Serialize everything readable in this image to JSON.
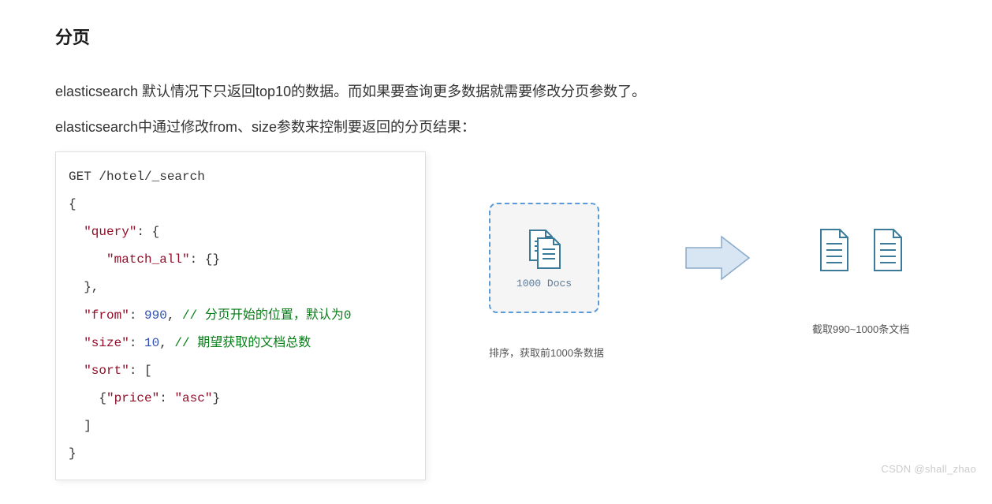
{
  "heading": "分页",
  "para1": "elasticsearch 默认情况下只返回top10的数据。而如果要查询更多数据就需要修改分页参数了。",
  "para2": "elasticsearch中通过修改from、size参数来控制要返回的分页结果：",
  "code": {
    "line1": "GET /hotel/_search",
    "open": "{",
    "queryKey": "\"query\"",
    "matchAllKey": "\"match_all\"",
    "fromKey": "\"from\"",
    "fromVal": "990",
    "fromComment": "// 分页开始的位置，默认为0",
    "sizeKey": "\"size\"",
    "sizeVal": "10",
    "sizeComment": "// 期望获取的文档总数",
    "sortKey": "\"sort\"",
    "priceKey": "\"price\"",
    "priceVal": "\"asc\"",
    "close": "}"
  },
  "diagram": {
    "docsLabel": "1000 Docs",
    "caption1": "排序，获取前1000条数据",
    "caption2": "截取990~1000条文档"
  },
  "watermark": "CSDN @shall_zhao"
}
